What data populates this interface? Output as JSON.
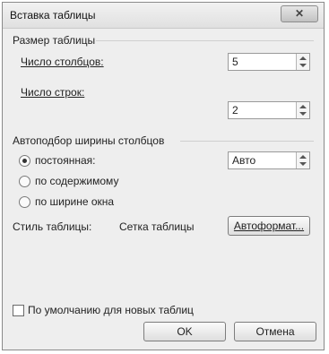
{
  "window": {
    "title": "Вставка таблицы",
    "close_glyph": "✕"
  },
  "size_group": {
    "title": "Размер таблицы",
    "columns_label": "Число столбцов:",
    "columns_value": "5",
    "rows_label": "Число строк:",
    "rows_value": "2"
  },
  "autofit_group": {
    "title": "Автоподбор ширины столбцов",
    "fixed_label": "постоянная:",
    "fixed_value": "Авто",
    "content_label": "по содержимому",
    "window_label": "по ширине окна",
    "selected": "fixed"
  },
  "style": {
    "label": "Стиль таблицы:",
    "value": "Сетка таблицы",
    "autoformat_button": "Автоформат..."
  },
  "default_checkbox": {
    "label": "По умолчанию для новых таблиц",
    "checked": false
  },
  "buttons": {
    "ok": "OK",
    "cancel": "Отмена"
  }
}
